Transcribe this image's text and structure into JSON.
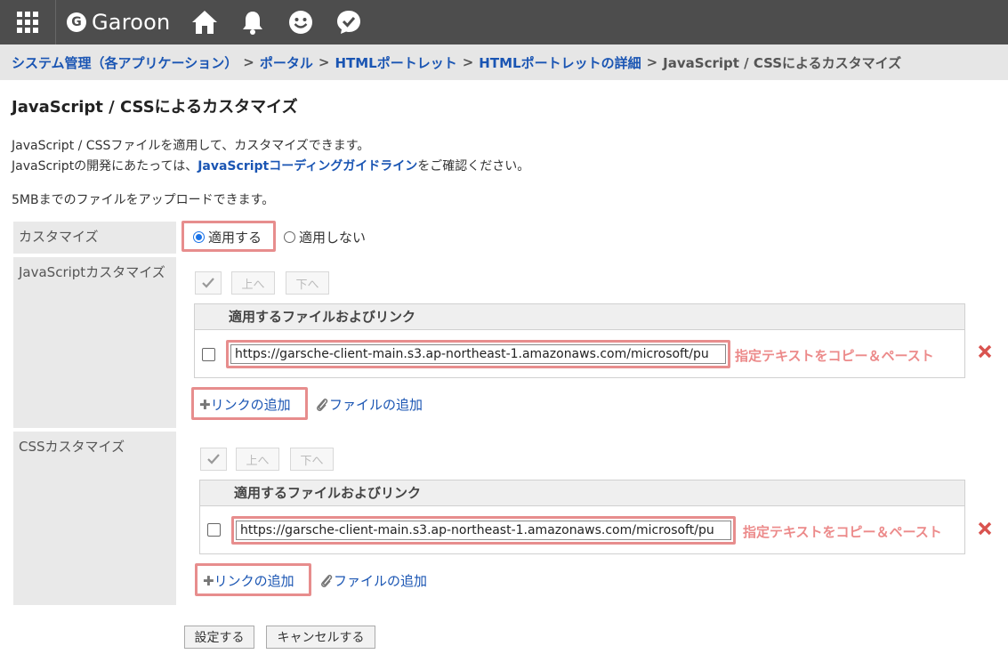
{
  "header": {
    "app_name": "Garoon",
    "logo_letter": "G",
    "icons": [
      "apps-grid-icon",
      "home-icon",
      "bell-icon",
      "smiley-icon",
      "check-bubble-icon"
    ]
  },
  "breadcrumb": {
    "items": [
      "システム管理（各アプリケーション）",
      "ポータル",
      "HTMLポートレット",
      "HTMLポートレットの詳細"
    ],
    "separator": ">",
    "current": "JavaScript / CSSによるカスタマイズ"
  },
  "page": {
    "title": "JavaScript / CSSによるカスタマイズ",
    "desc_line1": "JavaScript / CSSファイルを適用して、カスタマイズできます。",
    "desc_line2_pre": "JavaScriptの開発にあたっては、",
    "desc_line2_link": "JavaScriptコーディングガイドライン",
    "desc_line2_post": "をご確認ください。",
    "upload_note": "5MBまでのファイルをアップロードできます。"
  },
  "customize": {
    "label": "カスタマイズ",
    "option_apply": "適用する",
    "option_not_apply": "適用しない",
    "selected": "適用する"
  },
  "js_section": {
    "label": "JavaScriptカスタマイズ",
    "up_button": "上へ",
    "down_button": "下へ",
    "table_header": "適用するファイルおよびリンク",
    "url_value": "https://garsche-client-main.s3.ap-northeast-1.amazonaws.com/microsoft/pu",
    "note": "指定テキストをコピー＆ペースト",
    "add_link": "リンクの追加",
    "add_file": "ファイルの追加"
  },
  "css_section": {
    "label": "CSSカスタマイズ",
    "up_button": "上へ",
    "down_button": "下へ",
    "table_header": "適用するファイルおよびリンク",
    "url_value": "https://garsche-client-main.s3.ap-northeast-1.amazonaws.com/microsoft/pu",
    "note": "指定テキストをコピー＆ペースト",
    "add_link": "リンクの追加",
    "add_file": "ファイルの追加"
  },
  "footer": {
    "submit": "設定する",
    "cancel": "キャンセルする"
  },
  "colors": {
    "header_bg": "#4d4d4d",
    "link": "#1a55b3",
    "highlight": "#e78d8d",
    "note": "#ec8a8a",
    "delete": "#d9534f"
  }
}
